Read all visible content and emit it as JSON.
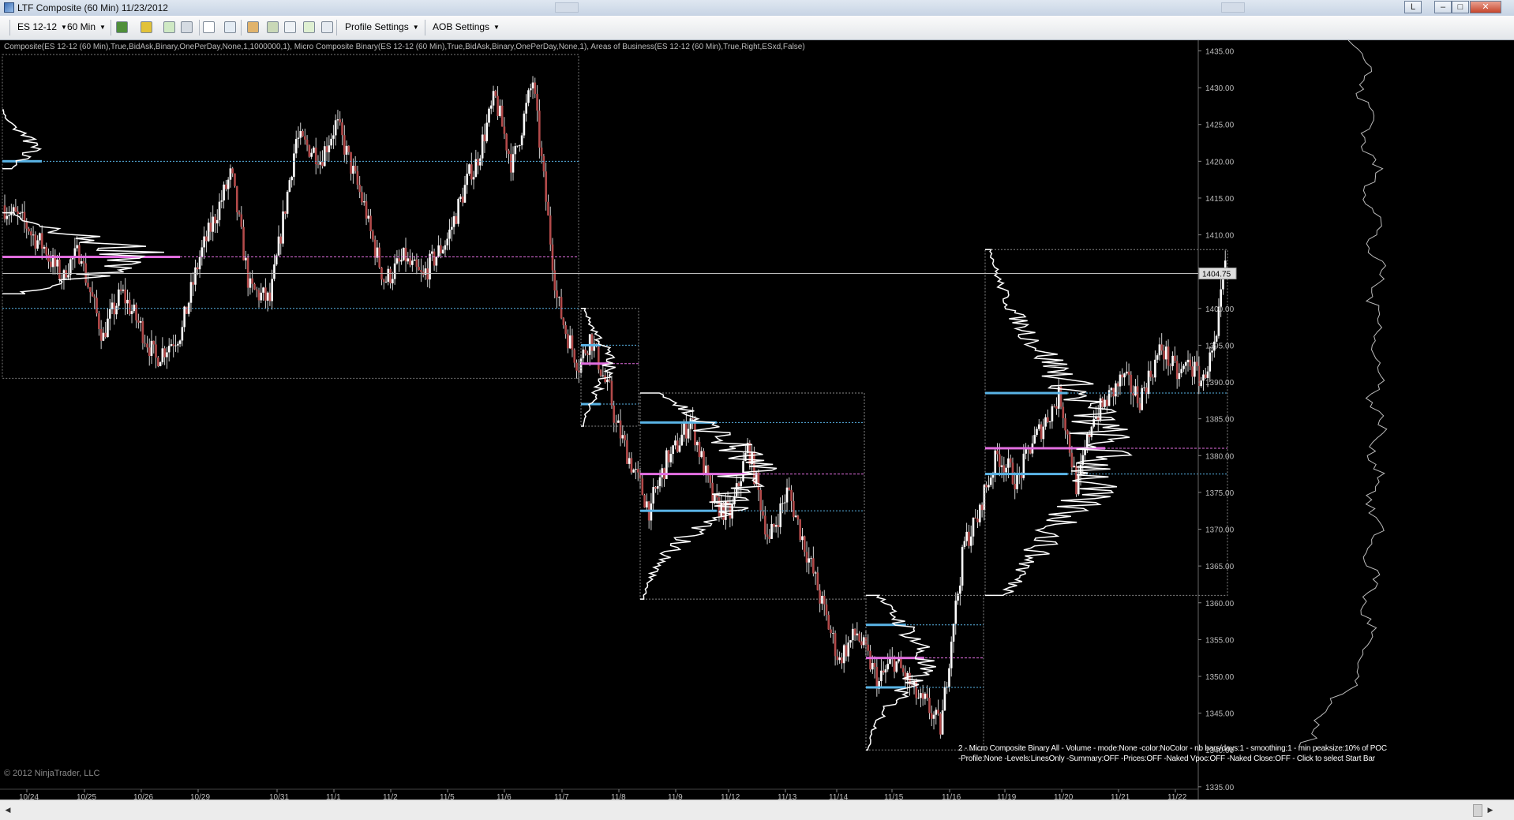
{
  "window": {
    "title": "LTF Composite (60 Min)  11/23/2012",
    "restore_label": "L",
    "minimize_label": "–",
    "maximize_label": "□",
    "close_label": "✕"
  },
  "toolbar": {
    "instrument": "ES 12-12",
    "interval": "60 Min",
    "profile_settings": "Profile Settings",
    "aob_settings": "AOB Settings"
  },
  "chart": {
    "indicator_description": "Composite(ES 12-12 (60 Min),True,BidAsk,Binary,OnePerDay,None,1,1000000,1), Micro Composite Binary(ES 12-12 (60 Min),True,BidAsk,Binary,OnePerDay,None,1), Areas of Business(ES 12-12 (60 Min),True,Right,ESxd,False)",
    "copyright": "© 2012 NinjaTrader, LLC",
    "settings_line1": "2 - Micro Composite Binary All - Volume - mode:None  -color:NoColor - nb bars/days:1 - smoothing:1 - min peaksize:10% of POC",
    "settings_line2": "-Profile:None -Levels:LinesOnly -Summary:OFF -Prices:OFF -Naked Vpoc:OFF -Naked Close:OFF - Click to select Start Bar",
    "last_price_label": "1404.75",
    "colors": {
      "background": "#000000",
      "value_area_line": "#5ab4e6",
      "poc_line": "#e26ee0",
      "bull_candle": "#ffffff",
      "bear_candle": "#b34a4a"
    }
  },
  "chart_data": {
    "type": "candlestick",
    "ylim": [
      1333,
      1438
    ],
    "y_ticks": [
      1435,
      1430,
      1425,
      1420,
      1415,
      1410,
      1405,
      1400,
      1395,
      1390,
      1385,
      1380,
      1375,
      1370,
      1365,
      1360,
      1355,
      1350,
      1345,
      1340,
      1335
    ],
    "y_tick_labels": [
      "1435.00",
      "1430.00",
      "1425.00",
      "1420.00",
      "1415.00",
      "1410.00",
      "1405.00",
      "1400.00",
      "1395.00",
      "1390.00",
      "1385.00",
      "1380.00",
      "1375.00",
      "1370.00",
      "1365.00",
      "1360.00",
      "1355.00",
      "1350.00",
      "1345.00",
      "1340.00",
      "1335.00"
    ],
    "x_labels": [
      "10/24",
      "10/25",
      "10/26",
      "10/29",
      "10/31",
      "11/1",
      "11/2",
      "11/5",
      "11/6",
      "11/7",
      "11/8",
      "11/9",
      "11/12",
      "11/13",
      "11/14",
      "11/15",
      "11/16",
      "11/19",
      "11/20",
      "11/21",
      "11/22"
    ],
    "last_price": 1404.75,
    "trajectory": [
      [
        1411,
        12
      ],
      [
        1408,
        8
      ],
      [
        1404,
        8
      ],
      [
        1408,
        8
      ],
      [
        1396,
        10
      ],
      [
        1402,
        8
      ],
      [
        1398,
        8
      ],
      [
        1393,
        8
      ],
      [
        1397,
        12
      ],
      [
        1407,
        8
      ],
      [
        1418,
        14
      ],
      [
        1404,
        8
      ],
      [
        1401,
        10
      ],
      [
        1423,
        12
      ],
      [
        1421,
        10
      ],
      [
        1425,
        8
      ],
      [
        1413,
        14
      ],
      [
        1404,
        8
      ],
      [
        1407,
        10
      ],
      [
        1404,
        8
      ],
      [
        1409,
        10
      ],
      [
        1419,
        12
      ],
      [
        1428,
        10
      ],
      [
        1420,
        8
      ],
      [
        1431,
        10
      ],
      [
        1404,
        10
      ],
      [
        1398,
        4
      ],
      [
        1393,
        6
      ],
      [
        1396,
        6
      ],
      [
        1389,
        8
      ],
      [
        1384,
        4
      ],
      [
        1378,
        8
      ],
      [
        1372,
        8
      ],
      [
        1380,
        8
      ],
      [
        1385,
        10
      ],
      [
        1374,
        10
      ],
      [
        1372,
        8
      ],
      [
        1381,
        8
      ],
      [
        1368,
        10
      ],
      [
        1375,
        8
      ],
      [
        1362,
        14
      ],
      [
        1352,
        10
      ],
      [
        1356,
        8
      ],
      [
        1349,
        10
      ],
      [
        1352,
        6
      ],
      [
        1349,
        8
      ],
      [
        1346,
        6
      ],
      [
        1343,
        8
      ],
      [
        1358,
        6
      ],
      [
        1366,
        4
      ],
      [
        1372,
        8
      ],
      [
        1380,
        8
      ],
      [
        1377,
        8
      ],
      [
        1382,
        8
      ],
      [
        1388,
        12
      ],
      [
        1376,
        8
      ],
      [
        1386,
        8
      ],
      [
        1390,
        12
      ],
      [
        1388,
        8
      ],
      [
        1394,
        10
      ],
      [
        1391,
        8
      ],
      [
        1393,
        6
      ],
      [
        1390,
        6
      ],
      [
        1395,
        6
      ],
      [
        1406,
        4
      ]
    ],
    "composite_box": {
      "top": 1434.5,
      "bottom": 1390.5,
      "poc": 1407,
      "vah": 1420,
      "val": 1400
    },
    "micro_composites": [
      {
        "start_date": "11/8",
        "end_date": "11/8",
        "top": 1400,
        "bottom": 1384,
        "poc": 1392.5,
        "vah": 1395,
        "val": 1387
      },
      {
        "start_date": "11/9",
        "end_date": "11/14",
        "top": 1388.5,
        "bottom": 1360.5,
        "poc": 1377.5,
        "vah": 1384.5,
        "val": 1372.5
      },
      {
        "start_date": "11/15",
        "end_date": "11/16",
        "top": 1361,
        "bottom": 1340,
        "poc": 1352.5,
        "vah": 1357,
        "val": 1348.5
      },
      {
        "start_date": "11/19",
        "end_date": "11/22",
        "top": 1408,
        "bottom": 1361,
        "poc": 1381,
        "vah": 1388.5,
        "val": 1377.5
      }
    ]
  }
}
